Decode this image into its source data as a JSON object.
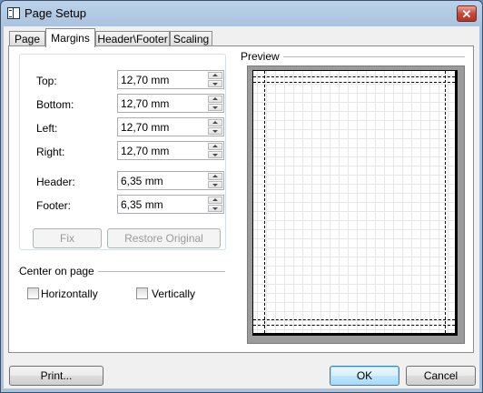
{
  "window": {
    "title": "Page Setup",
    "close_glyph": "✕"
  },
  "tabs": [
    {
      "label": "Page",
      "active": false
    },
    {
      "label": "Margins",
      "active": true
    },
    {
      "label": "Header\\Footer",
      "active": false
    },
    {
      "label": "Scaling",
      "active": false
    }
  ],
  "margins": {
    "top": {
      "label": "Top:",
      "value": "12,70 mm"
    },
    "bottom": {
      "label": "Bottom:",
      "value": "12,70 mm"
    },
    "left": {
      "label": "Left:",
      "value": "12,70 mm"
    },
    "right": {
      "label": "Right:",
      "value": "12,70 mm"
    },
    "header": {
      "label": "Header:",
      "value": "6,35 mm"
    },
    "footer": {
      "label": "Footer:",
      "value": "6,35 mm"
    }
  },
  "buttons": {
    "fix": "Fix",
    "restore": "Restore Original",
    "print": "Print...",
    "ok": "OK",
    "cancel": "Cancel"
  },
  "center_on_page": {
    "title": "Center on page",
    "horizontally": {
      "label": "Horizontally",
      "checked": false
    },
    "vertically": {
      "label": "Vertically",
      "checked": false
    }
  },
  "preview": {
    "title": "Preview"
  },
  "icons": {
    "app": "page-setup-icon",
    "close": "close-icon",
    "spin_up": "spin-up-icon",
    "spin_down": "spin-down-icon"
  }
}
